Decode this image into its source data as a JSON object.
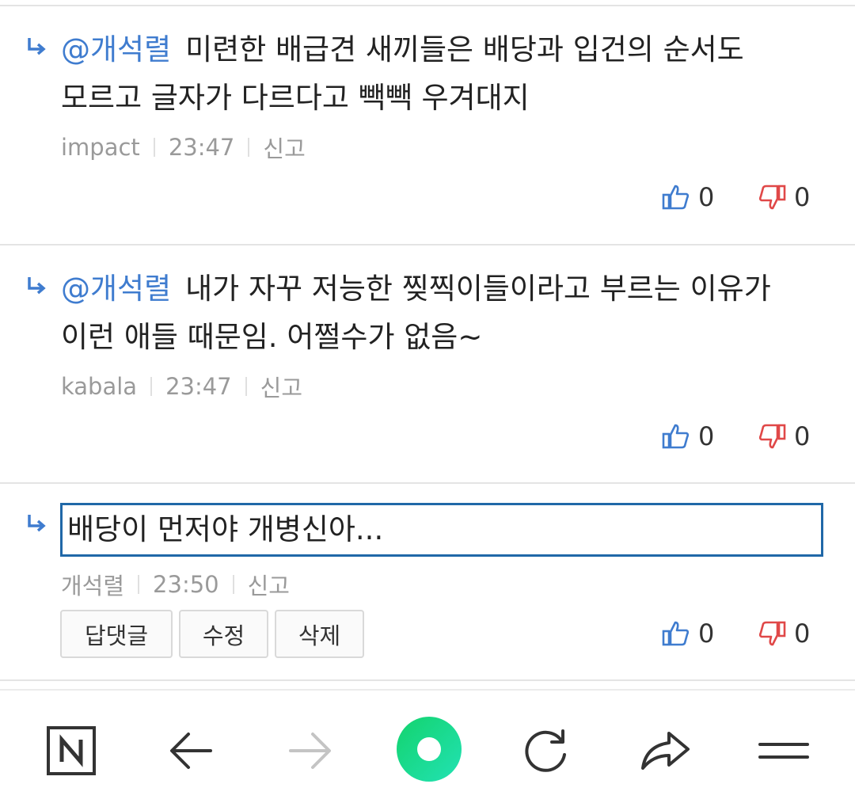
{
  "comments": [
    {
      "mention": "@개석렬",
      "text": "미련한 배급견 새끼들은 배당과 입건의 순서도 모르고 글자가 다르다고 빽빽 우겨대지",
      "author": "impact",
      "time": "23:47",
      "report": "신고",
      "likes": "0",
      "dislikes": "0"
    },
    {
      "mention": "@개석렬",
      "text": "내가 자꾸 저능한 찢찍이들이라고 부르는 이유가 이런 애들 때문임. 어쩔수가 없음~",
      "author": "kabala",
      "time": "23:47",
      "report": "신고",
      "likes": "0",
      "dislikes": "0"
    },
    {
      "text": "배당이 먼저야 개병신아...",
      "author": "개석렬",
      "time": "23:50",
      "report": "신고",
      "likes": "0",
      "dislikes": "0",
      "actions": {
        "reply": "답댓글",
        "edit": "수정",
        "delete": "삭제"
      }
    }
  ],
  "icons": {
    "reply": "reply-arrow-icon",
    "like": "thumbs-up-icon",
    "dislike": "thumbs-down-icon",
    "nav": [
      "naver-home-icon",
      "back-arrow-icon",
      "forward-arrow-icon",
      "green-dot-icon",
      "refresh-icon",
      "share-icon",
      "menu-icon"
    ]
  },
  "colors": {
    "mention": "#3f7ccf",
    "like": "#3f7ccf",
    "dislike": "#e04848",
    "focus_border": "#2068a8",
    "green": "#1ad86a"
  }
}
